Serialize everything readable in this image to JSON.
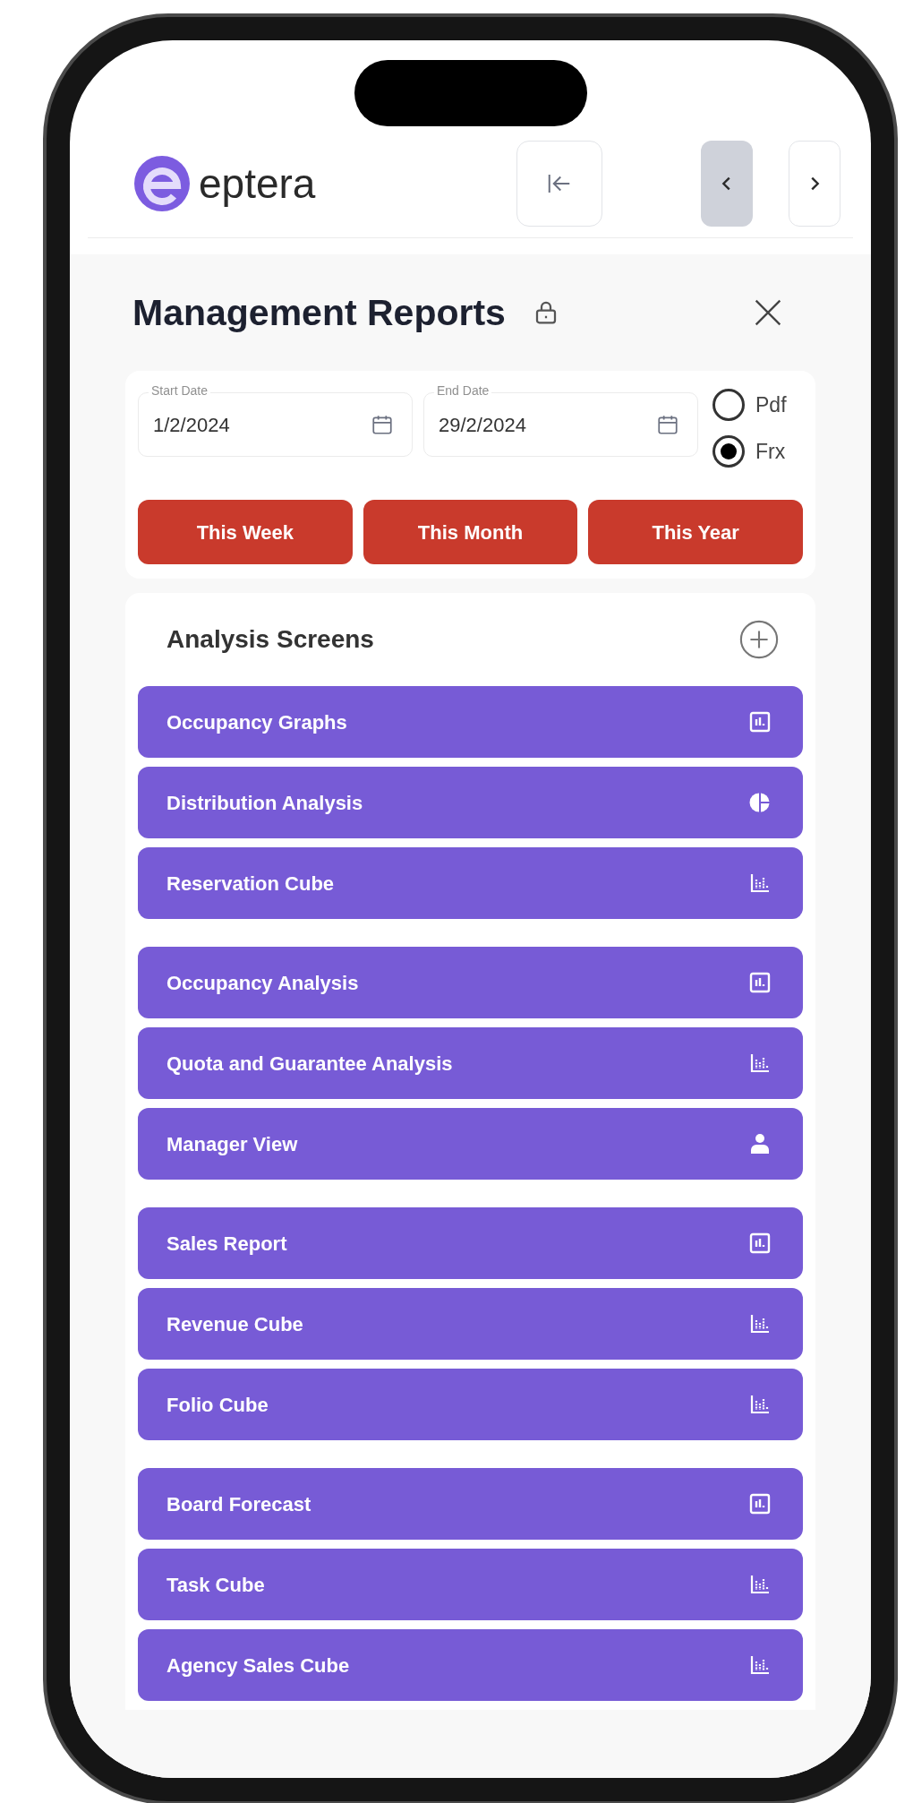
{
  "header": {
    "logo_text": "eptera"
  },
  "title": "Management Reports",
  "date_fields": [
    {
      "label": "Start Date",
      "value": "1/2/2024"
    },
    {
      "label": "End Date",
      "value": "29/2/2024"
    }
  ],
  "formats": [
    {
      "label": "Pdf",
      "selected": false
    },
    {
      "label": "Frx",
      "selected": true
    }
  ],
  "quick_ranges": [
    "This Week",
    "This Month",
    "This Year"
  ],
  "analysis": {
    "heading": "Analysis Screens",
    "groups": [
      {
        "items": [
          {
            "label": "Occupancy Graphs",
            "kind": "report"
          },
          {
            "label": "Distribution Analysis",
            "kind": "pie"
          },
          {
            "label": "Reservation Cube",
            "kind": "cube"
          }
        ]
      },
      {
        "items": [
          {
            "label": "Occupancy Analysis",
            "kind": "report"
          },
          {
            "label": "Quota and Guarantee Analysis",
            "kind": "cube"
          },
          {
            "label": "Manager View",
            "kind": "manager"
          }
        ]
      },
      {
        "items": [
          {
            "label": "Sales Report",
            "kind": "report"
          },
          {
            "label": "Revenue Cube",
            "kind": "cube"
          },
          {
            "label": "Folio Cube",
            "kind": "cube"
          }
        ]
      },
      {
        "items": [
          {
            "label": "Board Forecast",
            "kind": "report"
          },
          {
            "label": "Task Cube",
            "kind": "cube"
          },
          {
            "label": "Agency Sales Cube",
            "kind": "cube"
          }
        ]
      }
    ]
  }
}
